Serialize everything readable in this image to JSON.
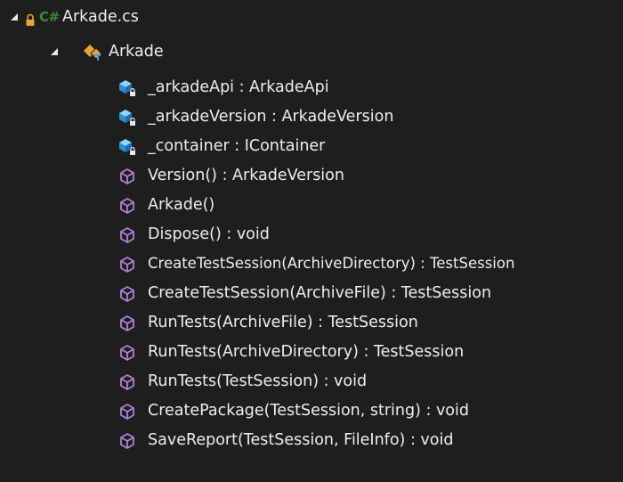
{
  "colors": {
    "background": "#1e1e1e",
    "text": "#eeeeee",
    "csharp_badge": "#388a34",
    "method_icon": "#b180d7",
    "field_icon": "#3aa0e6",
    "class_icon": "#e8a33d"
  },
  "file": {
    "lock_icon": "lock-icon",
    "badge": "C#",
    "name": "Arkade.cs"
  },
  "class": {
    "icon": "class-icon",
    "name": "Arkade"
  },
  "members": [
    {
      "kind": "field",
      "icon": "private-field-icon",
      "label": "_arkadeApi : ArkadeApi"
    },
    {
      "kind": "field",
      "icon": "private-field-icon",
      "label": "_arkadeVersion : ArkadeVersion"
    },
    {
      "kind": "field",
      "icon": "private-field-icon",
      "label": "_container : IContainer"
    },
    {
      "kind": "method",
      "icon": "method-icon",
      "label": "Version() : ArkadeVersion"
    },
    {
      "kind": "method",
      "icon": "method-icon",
      "label": "Arkade()"
    },
    {
      "kind": "method",
      "icon": "method-icon",
      "label": "Dispose() : void"
    },
    {
      "kind": "method",
      "icon": "method-icon",
      "label": "CreateTestSession(ArchiveDirectory) : TestSession"
    },
    {
      "kind": "method",
      "icon": "method-icon",
      "label": "CreateTestSession(ArchiveFile) : TestSession"
    },
    {
      "kind": "method",
      "icon": "method-icon",
      "label": "RunTests(ArchiveFile) : TestSession"
    },
    {
      "kind": "method",
      "icon": "method-icon",
      "label": "RunTests(ArchiveDirectory) : TestSession"
    },
    {
      "kind": "method",
      "icon": "method-icon",
      "label": "RunTests(TestSession) : void"
    },
    {
      "kind": "method",
      "icon": "method-icon",
      "label": "CreatePackage(TestSession, string) : void"
    },
    {
      "kind": "method",
      "icon": "method-icon",
      "label": "SaveReport(TestSession, FileInfo) : void"
    }
  ]
}
